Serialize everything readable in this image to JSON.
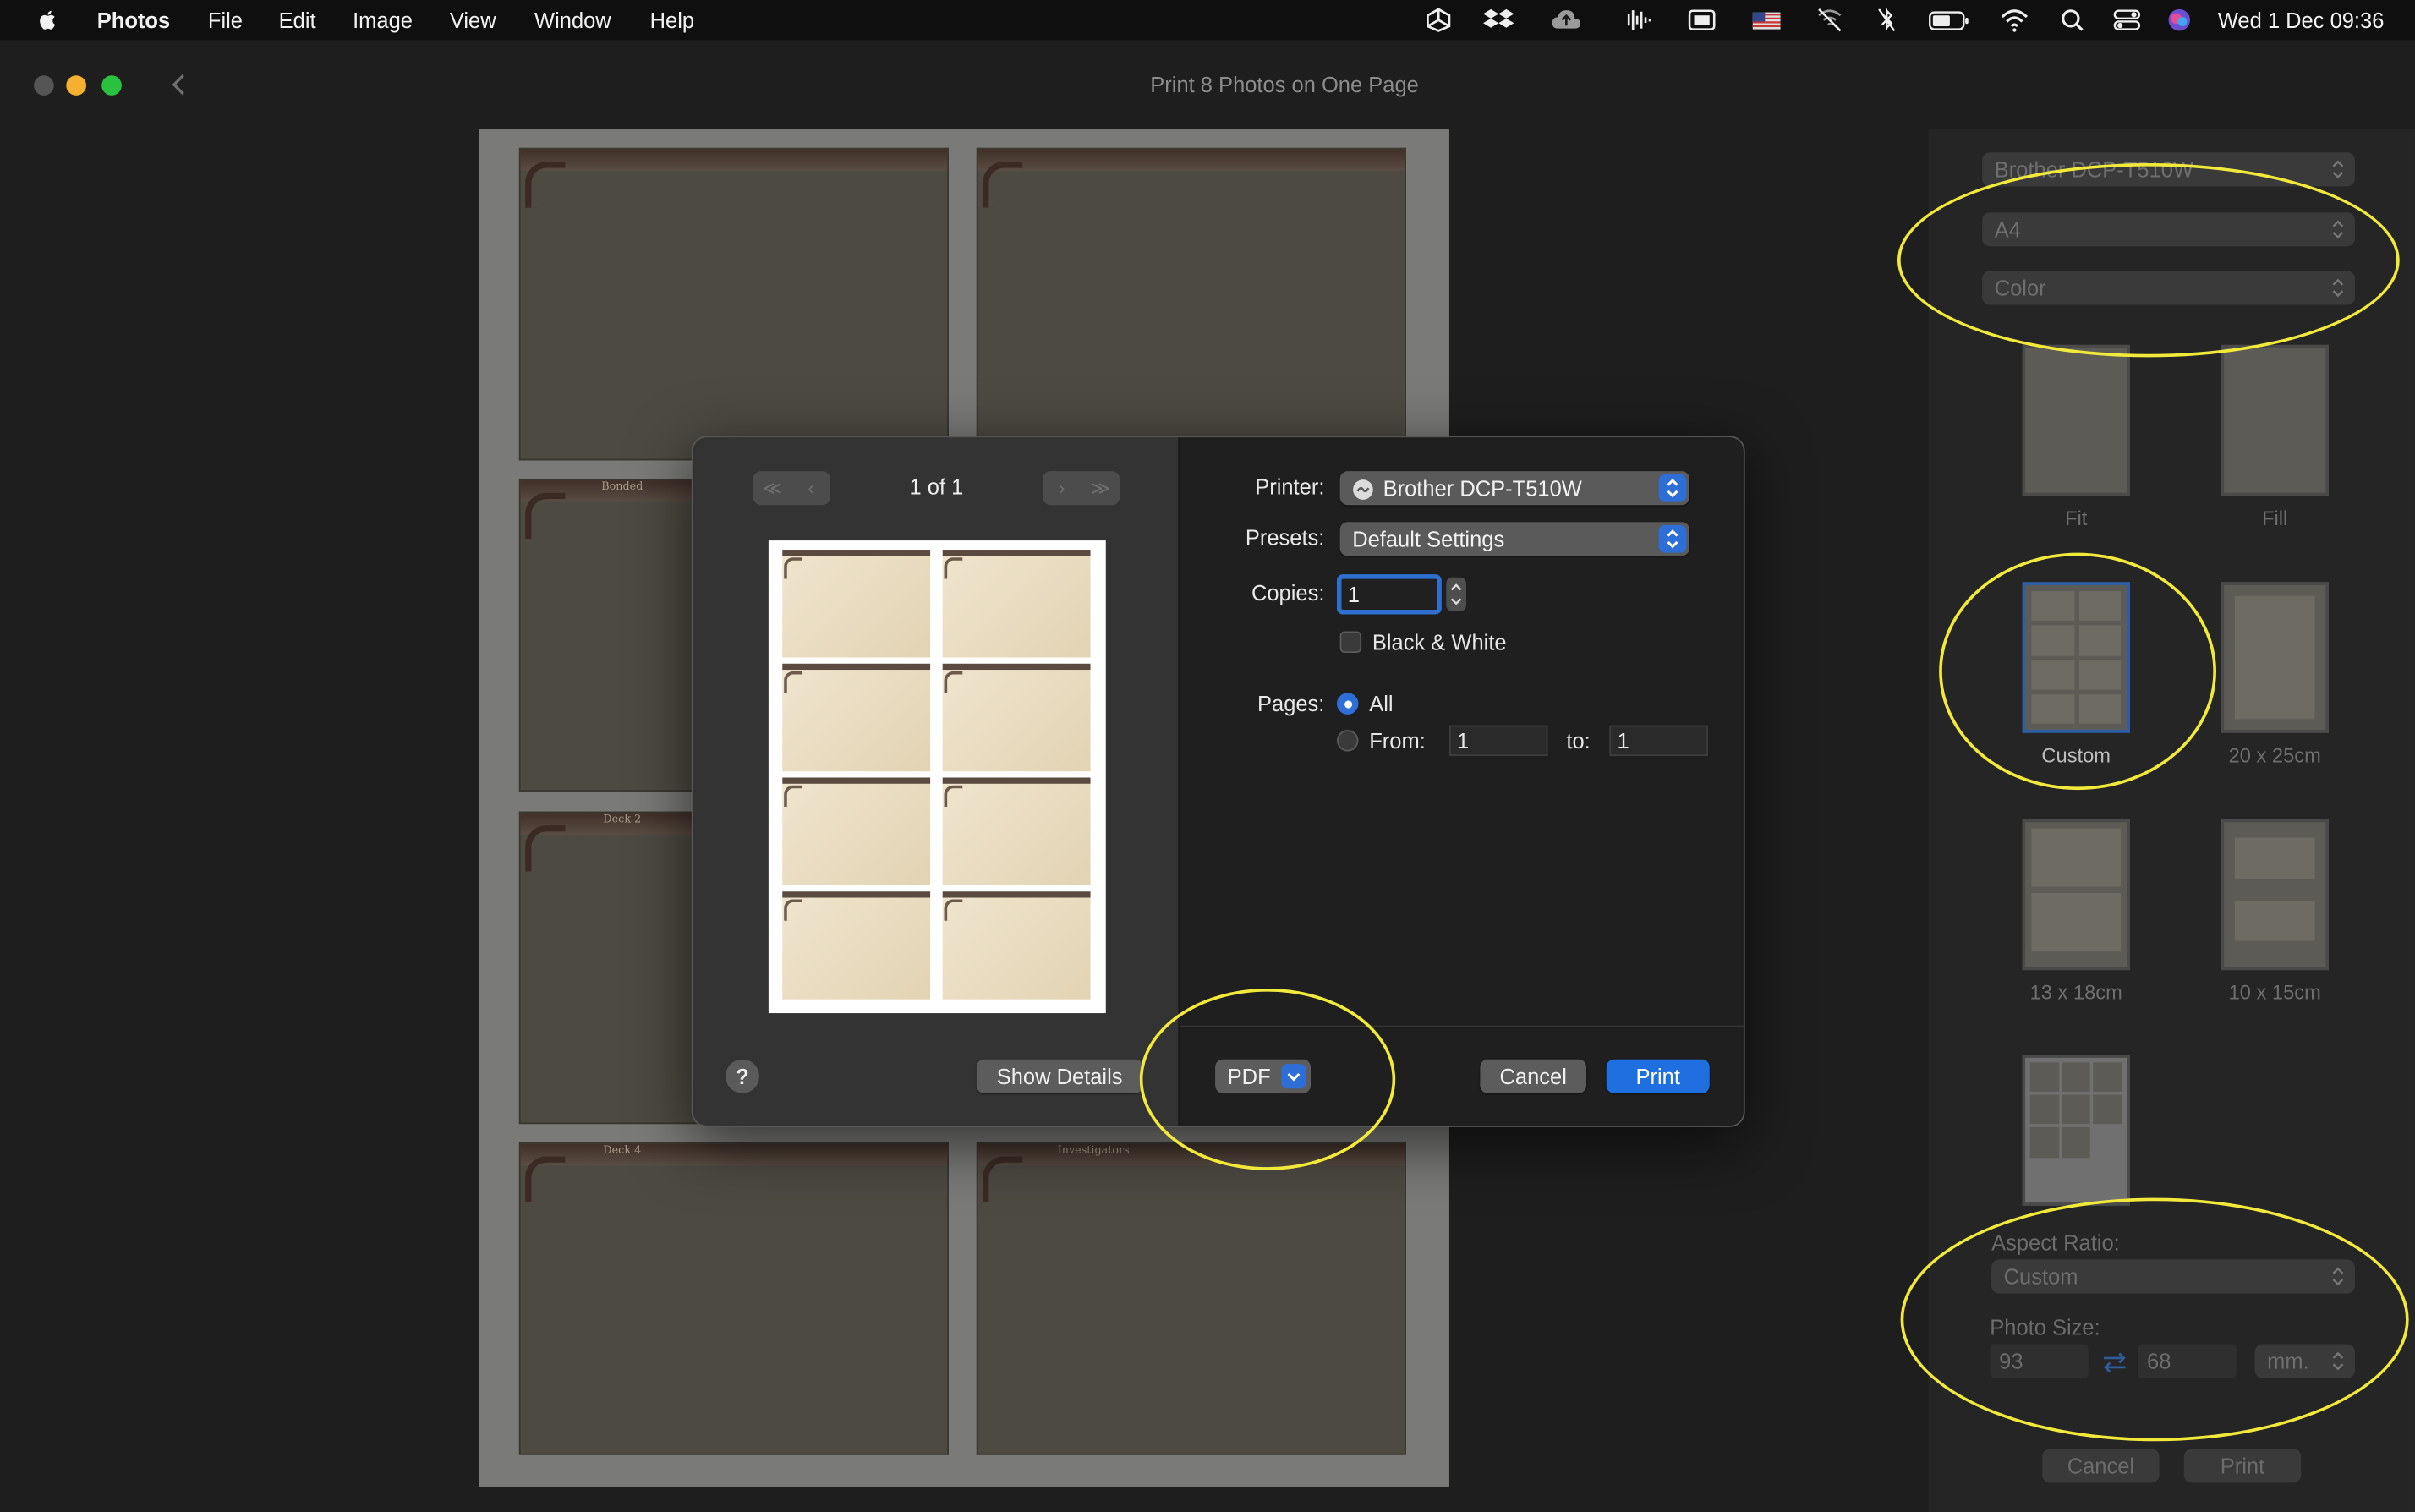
{
  "menubar": {
    "app_name": "Photos",
    "menus": [
      "File",
      "Edit",
      "Image",
      "View",
      "Window",
      "Help"
    ],
    "clock": "Wed 1 Dec  09:36"
  },
  "window": {
    "title": "Print 8 Photos on One Page"
  },
  "preview_page": {
    "tab_labels": [
      "Bonded",
      "Deck 2",
      "Deck 4",
      "Investigators"
    ]
  },
  "sidebar": {
    "printer": "Brother DCP-T510W",
    "paper": "A4",
    "color_mode": "Color",
    "layouts": [
      {
        "label": "Fit"
      },
      {
        "label": "Fill"
      },
      {
        "label": "Custom"
      },
      {
        "label": "20 x 25cm"
      },
      {
        "label": "13 x 18cm"
      },
      {
        "label": "10 x 15cm"
      }
    ],
    "aspect_ratio_label": "Aspect Ratio:",
    "aspect_ratio_value": "Custom",
    "photo_size_label": "Photo Size:",
    "width_value": "93",
    "height_value": "68",
    "unit": "mm.",
    "cancel_label": "Cancel",
    "print_label": "Print"
  },
  "print_dialog": {
    "page_indicator": "1 of 1",
    "printer_label": "Printer:",
    "printer_value": "Brother DCP-T510W",
    "presets_label": "Presets:",
    "presets_value": "Default Settings",
    "copies_label": "Copies:",
    "copies_value": "1",
    "bw_label": "Black & White",
    "pages_label": "Pages:",
    "pages_all_label": "All",
    "pages_from_label": "From:",
    "pages_from_value": "1",
    "pages_to_label": "to:",
    "pages_to_value": "1",
    "help_label": "?",
    "show_details_label": "Show Details",
    "pdf_label": "PDF",
    "cancel_label": "Cancel",
    "print_label": "Print"
  },
  "colors": {
    "accent": "#1f6fe0",
    "annotation": "#f2ea3a"
  }
}
